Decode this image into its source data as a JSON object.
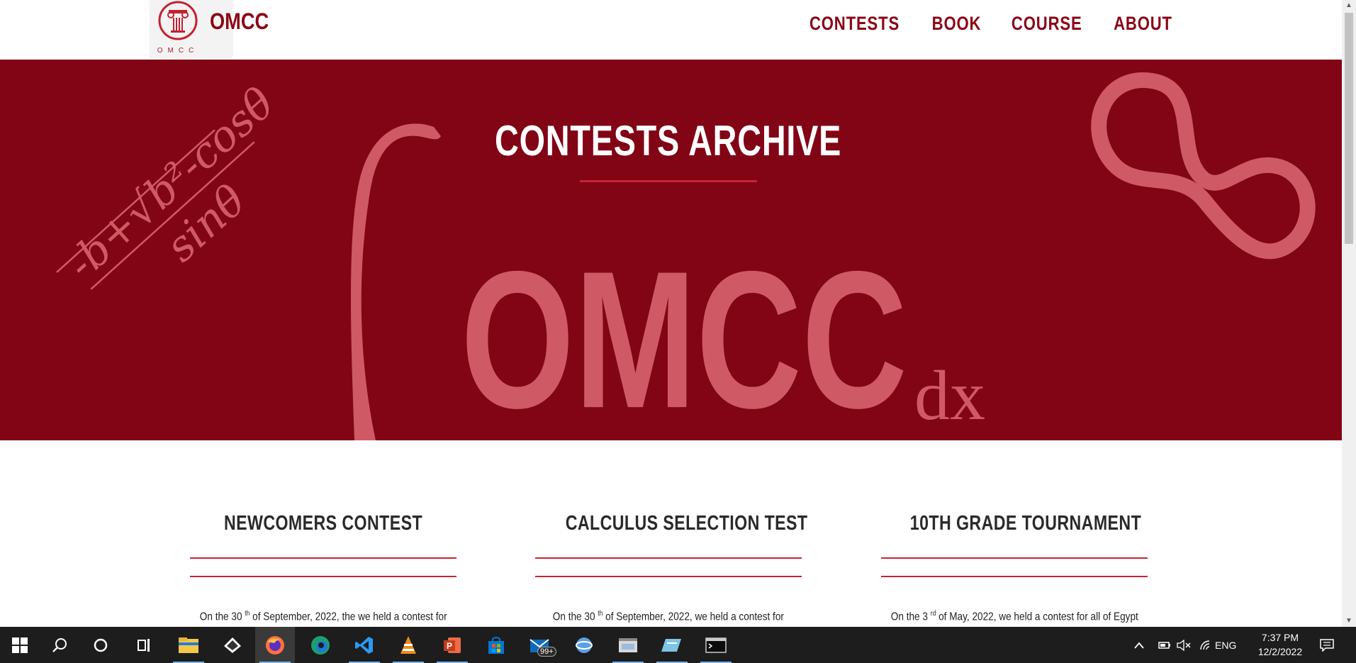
{
  "header": {
    "brand": "OMCC",
    "logo_small_text": "OMCC",
    "nav": [
      "CONTESTS",
      "BOOK",
      "COURSE",
      "ABOUT"
    ]
  },
  "hero": {
    "title": "CONTESTS ARCHIVE",
    "watermark_text": "OMCC",
    "watermark_dx": "dx",
    "formula_numerator": "-b+√b²-cosθ",
    "formula_denominator": "sinθ"
  },
  "cards": [
    {
      "title": "NEWCOMERS CONTEST",
      "text_pre": "On the 30",
      "text_sup": "th",
      "text_post": " of September, 2022, the we held a contest for"
    },
    {
      "title": "CALCULUS SELECTION TEST",
      "text_pre": "On the 30",
      "text_sup": "th",
      "text_post": " of September, 2022, we held a contest for"
    },
    {
      "title": "10TH GRADE TOURNAMENT",
      "text_pre": "On the 3",
      "text_sup": "rd",
      "text_post": " of May, 2022, we held a contest for all of Egypt"
    }
  ],
  "taskbar": {
    "mail_badge": "99+",
    "lang": "ENG",
    "time": "7:37 PM",
    "date": "12/2/2022"
  },
  "colors": {
    "brand": "#8b0516",
    "hero_bg": "#820515",
    "accent": "#c82434",
    "watermark": "#cf5a66"
  }
}
